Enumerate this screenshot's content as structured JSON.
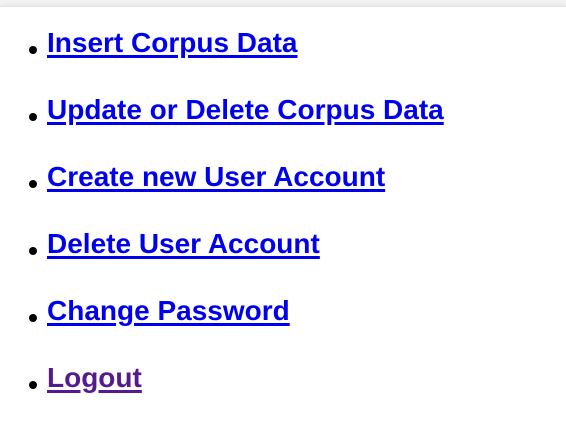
{
  "menu": {
    "items": [
      {
        "label": "Insert Corpus Data",
        "visited": false
      },
      {
        "label": "Update or Delete Corpus Data",
        "visited": false
      },
      {
        "label": "Create new User Account",
        "visited": false
      },
      {
        "label": "Delete User Account",
        "visited": false
      },
      {
        "label": "Change Password",
        "visited": false
      },
      {
        "label": "Logout",
        "visited": true
      }
    ]
  },
  "colors": {
    "link": "#0000ee",
    "visited_link": "#551a8b",
    "bullet": "#000000",
    "background": "#ffffff"
  }
}
